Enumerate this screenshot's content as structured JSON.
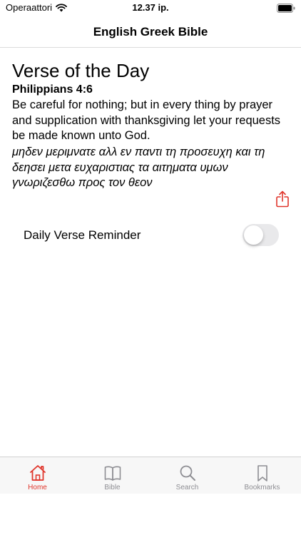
{
  "status_bar": {
    "carrier": "Operaattori",
    "time": "12.37 ip."
  },
  "nav": {
    "title": "English  Greek Bible"
  },
  "verse_of_day": {
    "heading": "Verse of the Day",
    "reference": "Philippians 4:6",
    "english_text": "Be careful for nothing; but in every thing by prayer and supplication with thanksgiving let your requests be made known unto God.",
    "greek_text": "μηδεν μεριμνατε αλλ εν παντι τη προσευχη και τη δεησει μετα ευχαριστιας τα αιτηματα υμων γνωριζεσθω προς τον θεον"
  },
  "reminder": {
    "label": "Daily Verse Reminder",
    "enabled": false
  },
  "tabs": [
    {
      "label": "Home",
      "icon": "home-icon",
      "active": true
    },
    {
      "label": "Bible",
      "icon": "book-icon",
      "active": false
    },
    {
      "label": "Search",
      "icon": "search-icon",
      "active": false
    },
    {
      "label": "Bookmarks",
      "icon": "bookmark-icon",
      "active": false
    }
  ],
  "colors": {
    "accent": "#e0352b",
    "inactive": "#8e8e93",
    "toggle_off": "#e9e9eb"
  }
}
